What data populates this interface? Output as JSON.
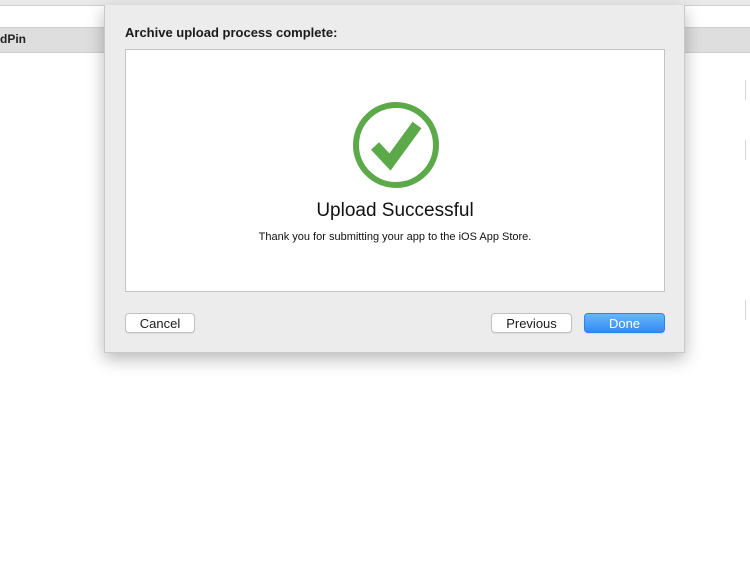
{
  "background": {
    "header_label": "dPin"
  },
  "dialog": {
    "title": "Archive upload process complete:",
    "status_title": "Upload Successful",
    "status_message": "Thank you for submitting your app to the iOS App Store.",
    "icon": "checkmark-circle-icon",
    "buttons": {
      "cancel": "Cancel",
      "previous": "Previous",
      "done": "Done"
    }
  },
  "colors": {
    "success_green": "#5ca94a",
    "primary_button_blue": "#3891f5"
  }
}
